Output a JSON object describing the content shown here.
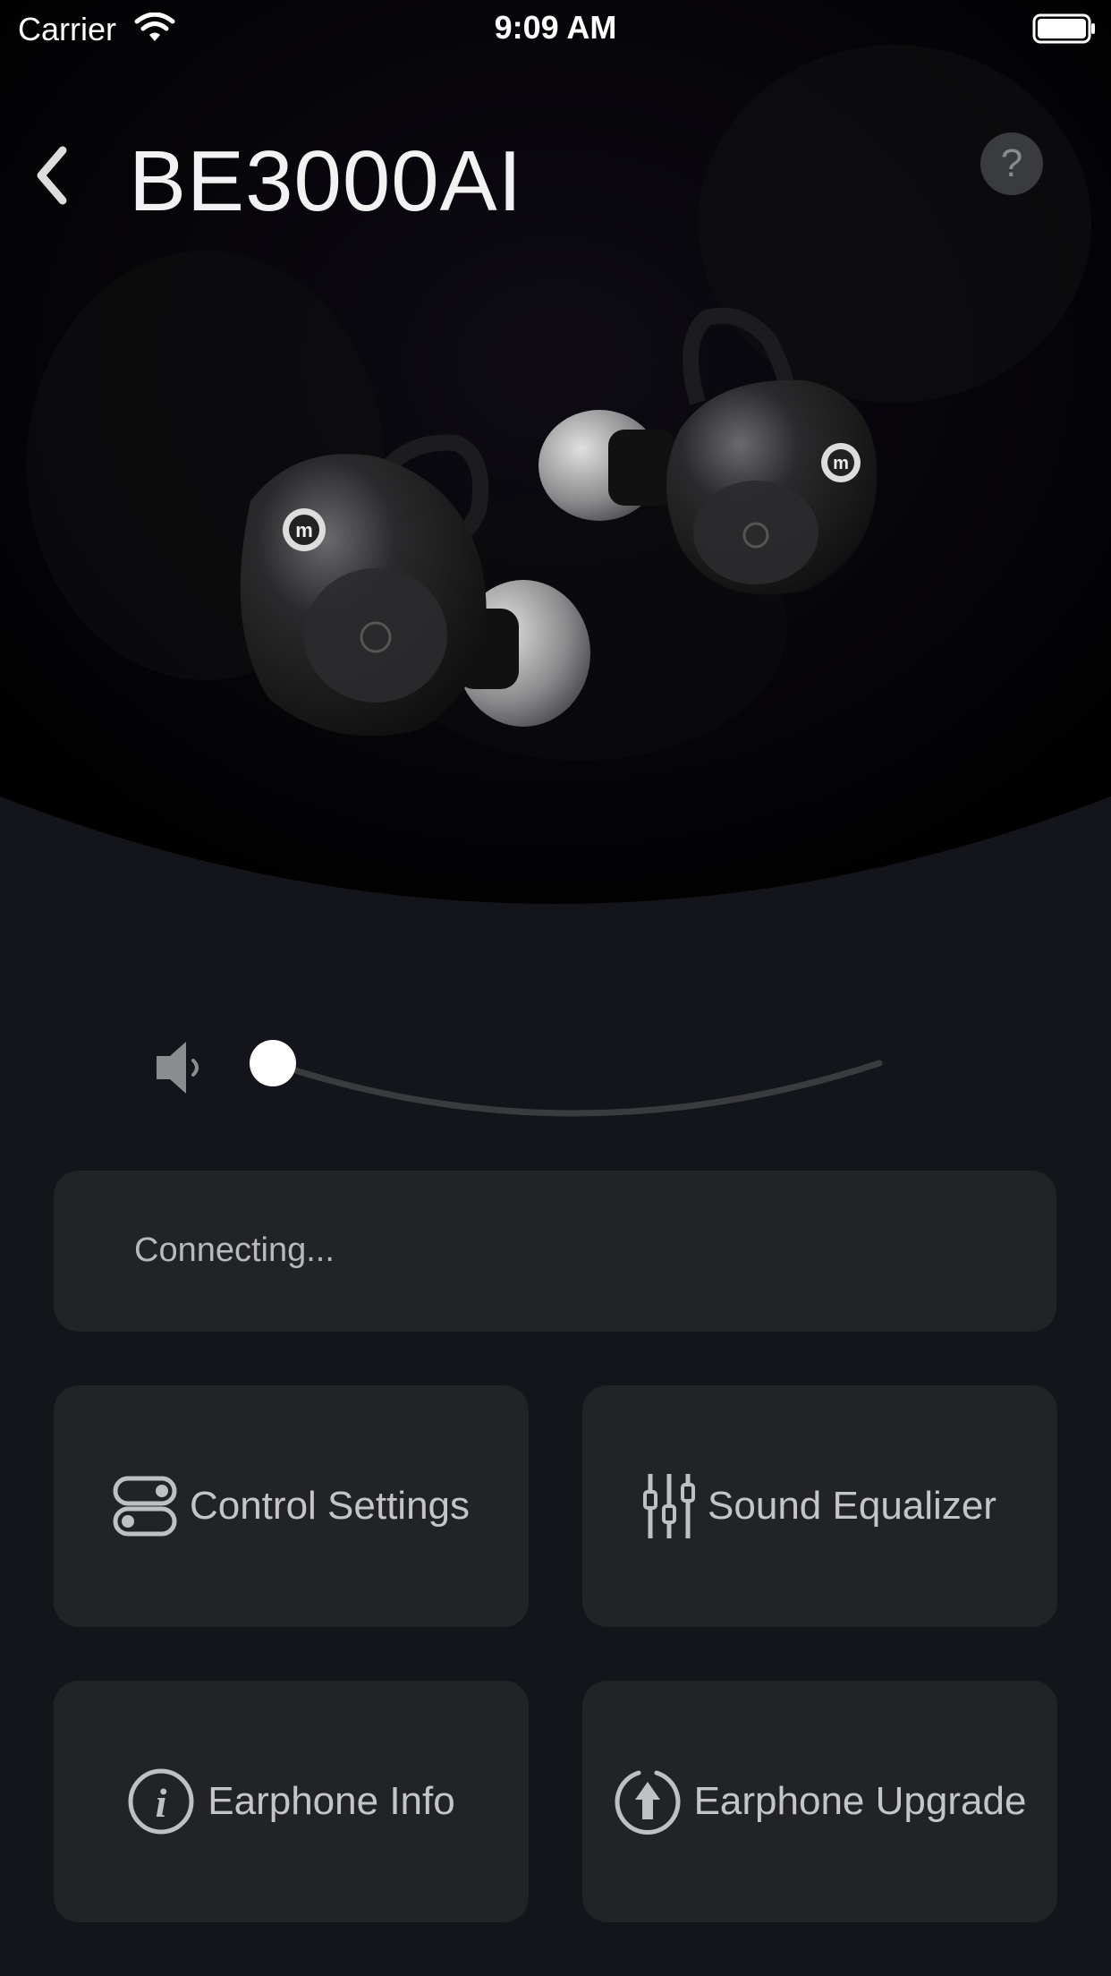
{
  "status_bar": {
    "carrier": "Carrier",
    "time": "9:09 AM"
  },
  "header": {
    "title": "BE3000AI",
    "help_label": "?"
  },
  "device_status": {
    "text": "Connecting..."
  },
  "volume": {
    "level": 0
  },
  "tiles": [
    {
      "label": "Control Settings",
      "icon": "toggle-switches-icon"
    },
    {
      "label": "Sound Equalizer",
      "icon": "equalizer-sliders-icon"
    },
    {
      "label": "Earphone Info",
      "icon": "info-circle-icon"
    },
    {
      "label": "Earphone Upgrade",
      "icon": "upgrade-arrow-icon"
    }
  ],
  "colors": {
    "background": "#14151a",
    "card": "#222327",
    "text": "#c4c5c9"
  }
}
